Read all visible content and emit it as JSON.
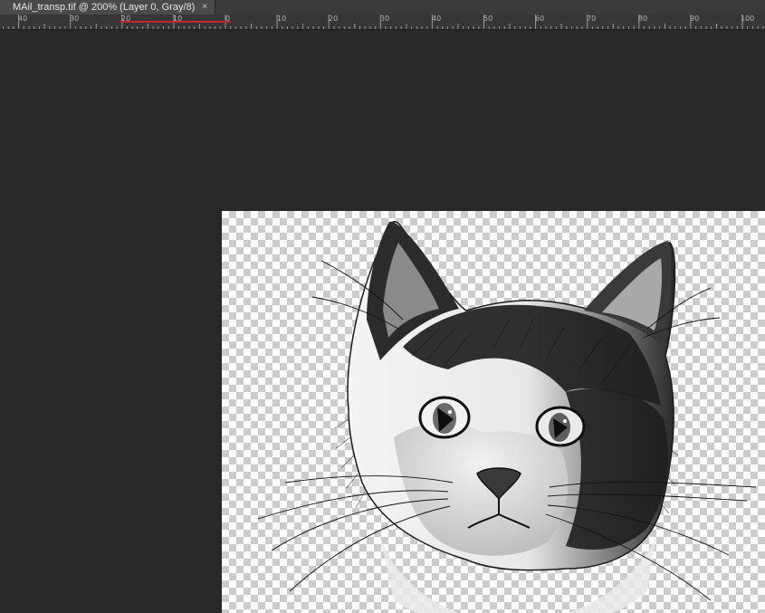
{
  "document_tab": {
    "title": "MAil_transp.tif @ 200% (Layer 0, Gray/8)",
    "close_glyph": "×"
  },
  "ruler": {
    "labels": [
      "40",
      "30",
      "20",
      "10",
      "0",
      "10",
      "20",
      "30",
      "40",
      "50",
      "60",
      "70",
      "80",
      "90",
      "100"
    ],
    "marker_color": "#c0272d"
  },
  "canvas": {
    "background": "#282828",
    "transparency_pattern": "checkerboard",
    "layer_content": "cat-sketch"
  }
}
